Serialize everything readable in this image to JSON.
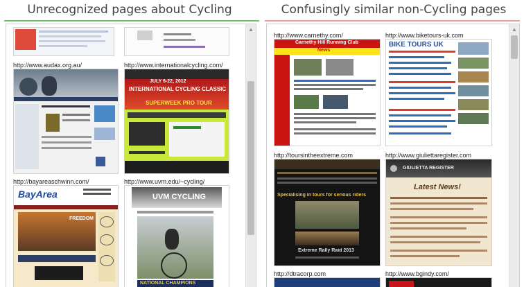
{
  "left_panel": {
    "title": "Unrecognized pages about Cycling",
    "accent": "#6cc06c",
    "items": [
      {
        "url": ""
      },
      {
        "url": ""
      },
      {
        "url": "http://www.audax.org.au/"
      },
      {
        "url": "http://www.internationalcycling.com/",
        "headline": "INTERNATIONAL CYCLING CLASSIC",
        "subhead": "SUPERWEEK PRO TOUR",
        "date": "JULY 6-22, 2012"
      },
      {
        "url": "http://bayareaschwinn.com/",
        "logo": "BayArea",
        "badge": "FREEDOM"
      },
      {
        "url": "http://www.uvm.edu/~cycling/",
        "headline": "UVM CYCLING",
        "footer": "NATIONAL CHAMPIONS"
      }
    ]
  },
  "right_panel": {
    "title": "Confusingly similar non-Cycling pages",
    "accent": "#e99b9b",
    "items": [
      {
        "url": "http://www.carnethy.com/",
        "headline": "Carnethy Hill Running Club",
        "nav": "News"
      },
      {
        "url": "http://www.biketours-uk.com",
        "headline": "BIKE TOURS UK"
      },
      {
        "url": "http://toursintheextreme.com",
        "headline": "Specialising in tours for serious riders",
        "caption": "Extreme Rally Raid 2013"
      },
      {
        "url": "http://www.giuliettaregister.com",
        "headline": "GIULIETTA REGISTER",
        "subhead": "Latest News!"
      },
      {
        "url": "http://dtracorp.com"
      },
      {
        "url": "http://www.bgindy.com/"
      }
    ]
  }
}
